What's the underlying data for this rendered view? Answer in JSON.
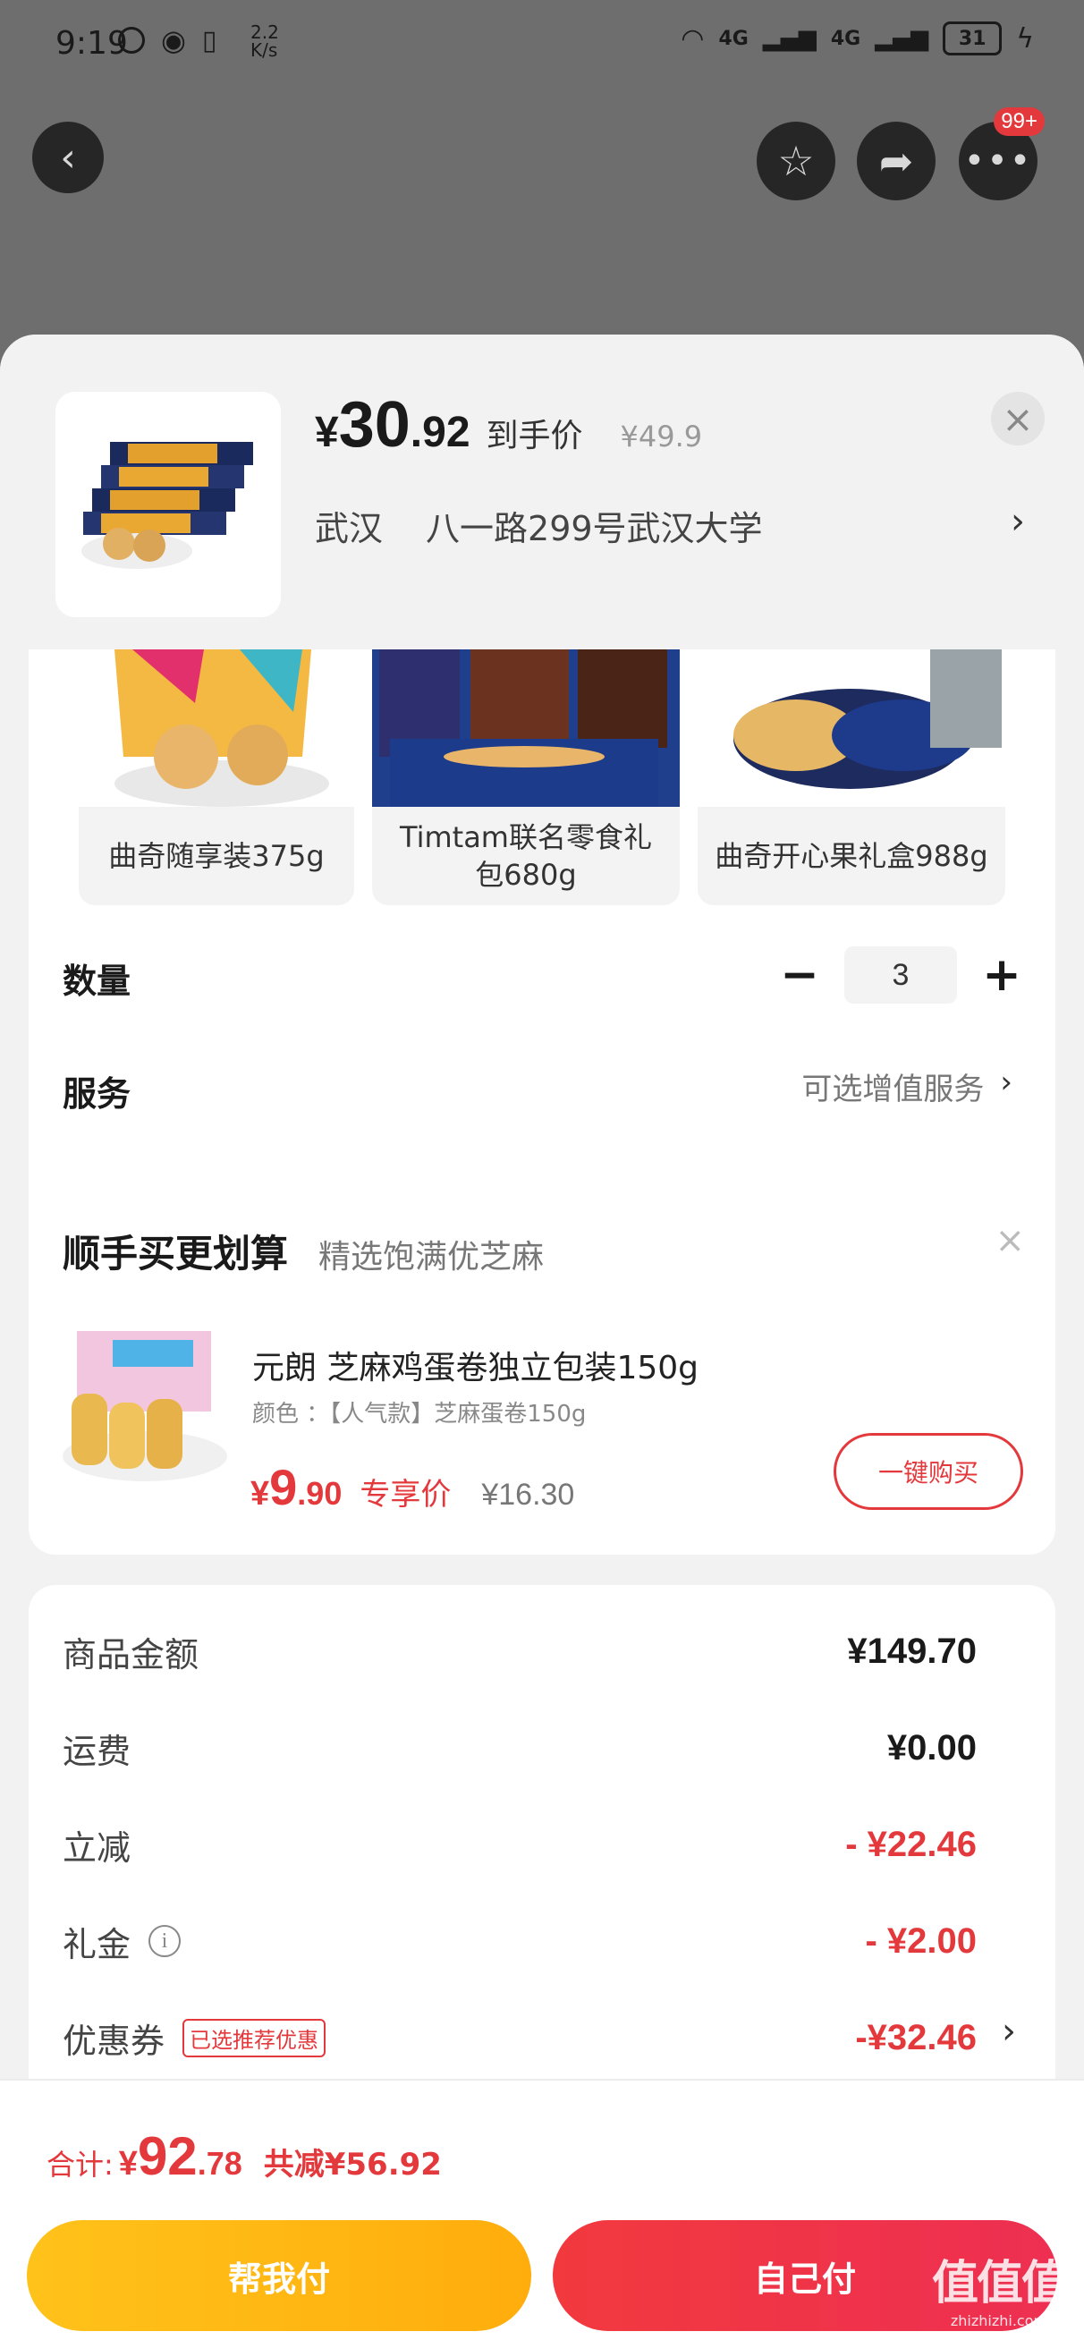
{
  "status_bar": {
    "time": "9:19",
    "net_speed_value": "2.2",
    "net_speed_unit": "K/s",
    "net1": "4G",
    "net2": "4G",
    "battery": "31"
  },
  "top_bar": {
    "badge": "99+"
  },
  "product": {
    "price_symbol": "¥",
    "price_int": "30",
    "price_dec": ".92",
    "price_tag": "到手价",
    "original_price": "¥49.9",
    "address_city": "武汉",
    "address_detail": "八一路299号武汉大学"
  },
  "variants": [
    {
      "label": "曲奇随享装375g"
    },
    {
      "label": "Timtam联名零食礼包680g"
    },
    {
      "label": "曲奇开心果礼盒988g"
    }
  ],
  "quantity": {
    "label": "数量",
    "minus": "−",
    "value": "3",
    "plus": "+"
  },
  "service": {
    "label": "服务",
    "value": "可选增值服务"
  },
  "bundle": {
    "title": "顺手买更划算",
    "subtitle": "精选饱满优芝麻",
    "item_name": "元朗  芝麻鸡蛋卷独立包装150g",
    "item_spec": "颜色 ：【人气款】芝麻蛋卷150g",
    "price_symbol": "¥",
    "price_int": "9",
    "price_dec": ".90",
    "price_tag": "专享价",
    "original_price": "¥16.30",
    "buy_button": "一键购买"
  },
  "summary": [
    {
      "label": "商品金额",
      "amount": "¥149.70",
      "emphasis": "normal"
    },
    {
      "label": "运费",
      "amount": "¥0.00",
      "emphasis": "normal"
    },
    {
      "label": "立减",
      "amount": "- ¥22.46",
      "emphasis": "red"
    },
    {
      "label": "礼金",
      "amount": "- ¥2.00",
      "emphasis": "red"
    },
    {
      "label": "优惠券",
      "amount": "-¥32.46",
      "emphasis": "red",
      "badge": "已选推荐优惠"
    }
  ],
  "footer": {
    "total_label": "合计:",
    "total_symbol": "¥",
    "total_int": "92",
    "total_dec": ".78",
    "saved": "共减¥56.92",
    "help_pay": "帮我付",
    "self_pay": "自己付",
    "watermark": "值值值",
    "watermark_site": "zhizhizhi.com"
  },
  "colors": {
    "accent_red": "#e4393c",
    "help_yellow": "#ffb811",
    "overlay_gray": "#6e6e6e"
  }
}
